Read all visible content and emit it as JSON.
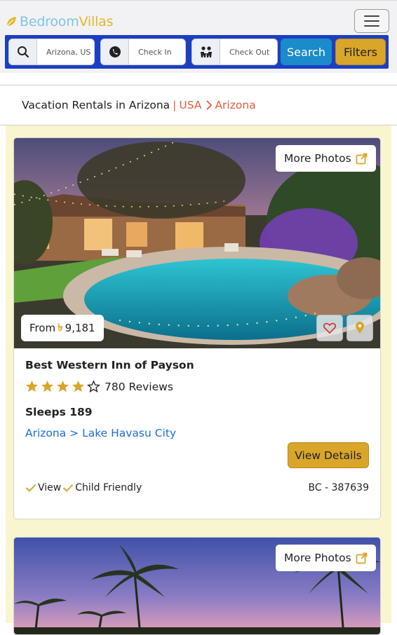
{
  "header": {
    "logo_part1": "Bedroom",
    "logo_part2": "Villas",
    "menu_icon": "hamburger-icon"
  },
  "search": {
    "location_value": "Arizona, US",
    "checkin_placeholder": "Check In",
    "checkout_placeholder": "Check Out",
    "search_label": "Search",
    "filters_label": "Filters",
    "icons": [
      "search-icon",
      "phone-icon",
      "guests-icon"
    ]
  },
  "breadcrumb": {
    "title": "Vacation Rentals in Arizona",
    "separator": "|",
    "country": "USA",
    "region": "Arizona"
  },
  "listings": [
    {
      "more_photos": "More Photos",
      "price_prefix": "From",
      "currency_symbol": "৳",
      "price": "9,181",
      "name": "Best Western Inn of Payson",
      "rating_stars": 4,
      "rating_max": 5,
      "reviews": "780 Reviews",
      "sleeps": "Sleeps 189",
      "location": "Arizona > Lake Havasu City",
      "details_label": "View Details",
      "features": [
        "View",
        "Child Friendly"
      ],
      "code": "BC - 387639"
    },
    {
      "more_photos": "More Photos"
    }
  ],
  "colors": {
    "accent_gold": "#d9a62a",
    "search_bar": "#1c3fc1",
    "search_button": "#1c8bc9",
    "breadcrumb_red": "#e45c3a",
    "link_blue": "#1a6fd6",
    "listing_bg": "#f8f5cf"
  }
}
